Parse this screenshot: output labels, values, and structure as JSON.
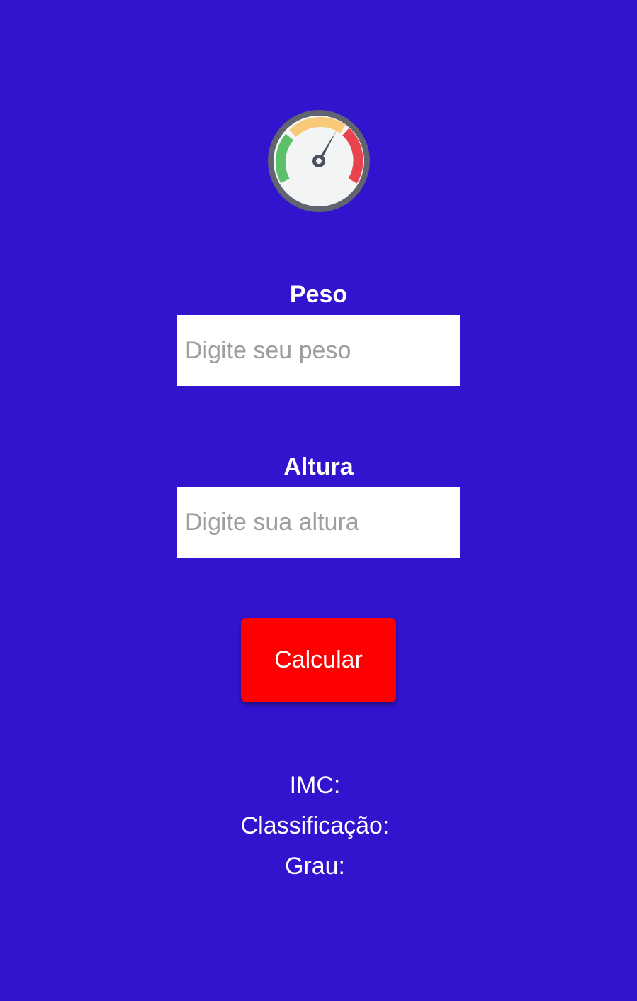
{
  "app": {
    "logo_icon": "speedometer-gauge-icon",
    "background_color": "#3214CF"
  },
  "form": {
    "weight": {
      "label": "Peso",
      "placeholder": "Digite seu peso",
      "value": ""
    },
    "height": {
      "label": "Altura",
      "placeholder": "Digite sua altura",
      "value": ""
    },
    "calculate_button": {
      "label": "Calcular",
      "color": "#FF0000"
    }
  },
  "results": {
    "imc_label": "IMC:",
    "classification_label": "Classificação:",
    "grade_label": "Grau:"
  }
}
